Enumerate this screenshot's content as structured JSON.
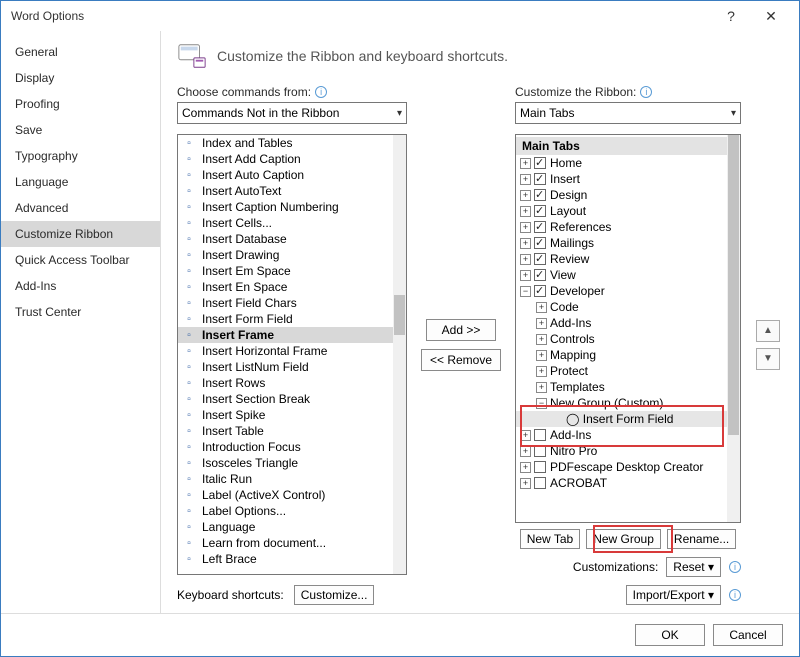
{
  "title": "Word Options",
  "heading": "Customize the Ribbon and keyboard shortcuts.",
  "sidebar": {
    "items": [
      "General",
      "Display",
      "Proofing",
      "Save",
      "Typography",
      "Language",
      "Advanced",
      "Customize Ribbon",
      "Quick Access Toolbar",
      "Add-Ins",
      "Trust Center"
    ],
    "selected": "Customize Ribbon"
  },
  "left": {
    "label": "Choose commands from:",
    "combo": "Commands Not in the Ribbon",
    "commands": [
      "Index and Tables",
      "Insert Add Caption",
      "Insert Auto Caption",
      "Insert AutoText",
      "Insert Caption Numbering",
      "Insert Cells...",
      "Insert Database",
      "Insert Drawing",
      "Insert Em Space",
      "Insert En Space",
      "Insert Field Chars",
      "Insert Form Field",
      "Insert Frame",
      "Insert Horizontal Frame",
      "Insert ListNum Field",
      "Insert Rows",
      "Insert Section Break",
      "Insert Spike",
      "Insert Table",
      "Introduction Focus",
      "Isosceles Triangle",
      "Italic Run",
      "Label (ActiveX Control)",
      "Label Options...",
      "Language",
      "Learn from document...",
      "Left Brace"
    ],
    "selected": "Insert Frame"
  },
  "mid": {
    "add": "Add >>",
    "remove": "<< Remove"
  },
  "right": {
    "label": "Customize the Ribbon:",
    "combo": "Main Tabs",
    "root": "Main Tabs",
    "tabs": [
      "Home",
      "Insert",
      "Design",
      "Layout",
      "References",
      "Mailings",
      "Review",
      "View"
    ],
    "developer": {
      "label": "Developer",
      "children": [
        "Code",
        "Add-Ins",
        "Controls",
        "Mapping",
        "Protect",
        "Templates"
      ],
      "custom_group": "New Group (Custom)",
      "custom_item": "Insert Form Field"
    },
    "extras": [
      "Add-Ins",
      "Nitro Pro",
      "PDFescape Desktop Creator",
      "ACROBAT"
    ],
    "buttons": {
      "newtab": "New Tab",
      "newgroup": "New Group",
      "rename": "Rename..."
    },
    "customizations_label": "Customizations:",
    "reset": "Reset ▾",
    "importexport": "Import/Export ▾"
  },
  "kbd": {
    "label": "Keyboard shortcuts:",
    "button": "Customize..."
  },
  "footer": {
    "ok": "OK",
    "cancel": "Cancel"
  }
}
